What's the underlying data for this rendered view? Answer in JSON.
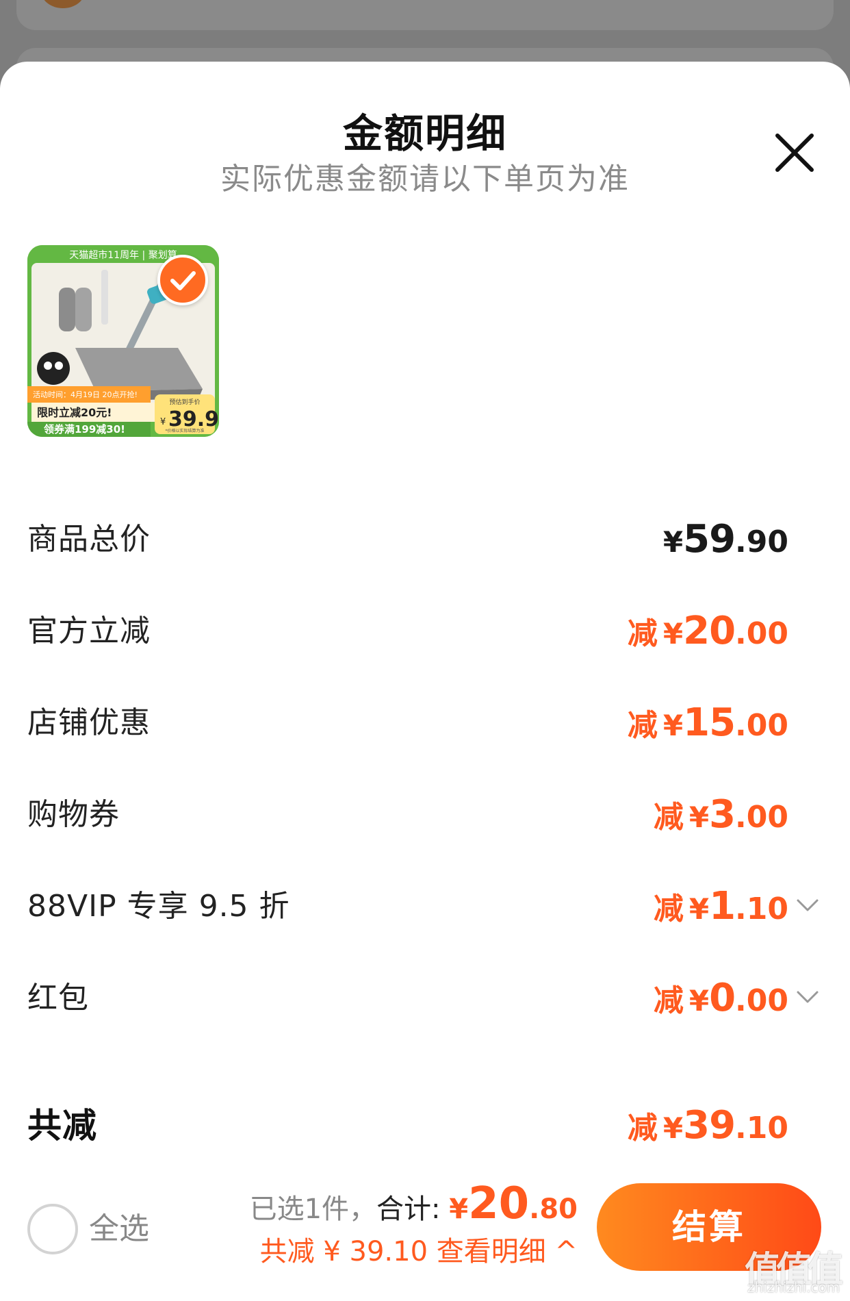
{
  "sheet": {
    "title": "金额明细",
    "subtitle": "实际优惠金额请以下单页为准"
  },
  "product": {
    "banner_top": "天猫超市11周年 | 聚划算",
    "promo_time": "活动时间：4月19日 20点开抢!",
    "promo_line1": "限时立减20元!",
    "promo_line2": "领券满199减30!",
    "price_label": "预估到手价",
    "price_yen": "¥",
    "price_value": "39.9",
    "price_note": "*价格以实际结算为准"
  },
  "rows": [
    {
      "label": "商品总价",
      "prefix": "",
      "yen": "¥",
      "int": "59",
      "dec": ".90",
      "color": "#1a1a1a"
    },
    {
      "label": "官方立减",
      "prefix": "减",
      "yen": "¥",
      "int": "20",
      "dec": ".00",
      "color": "#ff5a1f"
    },
    {
      "label": "店铺优惠",
      "prefix": "减",
      "yen": "¥",
      "int": "15",
      "dec": ".00",
      "color": "#ff5a1f"
    },
    {
      "label": "购物券",
      "prefix": "减",
      "yen": "¥",
      "int": "3",
      "dec": ".00",
      "color": "#ff5a1f"
    },
    {
      "label": "88VIP 专享 9.5 折",
      "prefix": "减",
      "yen": "¥",
      "int": "1",
      "dec": ".10",
      "color": "#ff5a1f"
    },
    {
      "label": "红包",
      "prefix": "减",
      "yen": "¥",
      "int": "0",
      "dec": ".00",
      "color": "#ff5a1f"
    }
  ],
  "total": {
    "label": "共减",
    "prefix": "减",
    "yen": "¥",
    "int": "39",
    "dec": ".10"
  },
  "footer": {
    "select_all": "全选",
    "selected": "已选1件，",
    "total_label": "合计:",
    "yen": "¥",
    "total_int": "20",
    "total_dec": ".80",
    "saved_text": "共减 ¥ 39.10 查看明细",
    "caret": "^",
    "checkout": "结算"
  },
  "watermark": {
    "main": "值值值",
    "sub": "zhizhizhi.com"
  },
  "colors": {
    "accent": "#ff5a1f",
    "button_start": "#ff8a1f",
    "button_end": "#ff4a17"
  }
}
